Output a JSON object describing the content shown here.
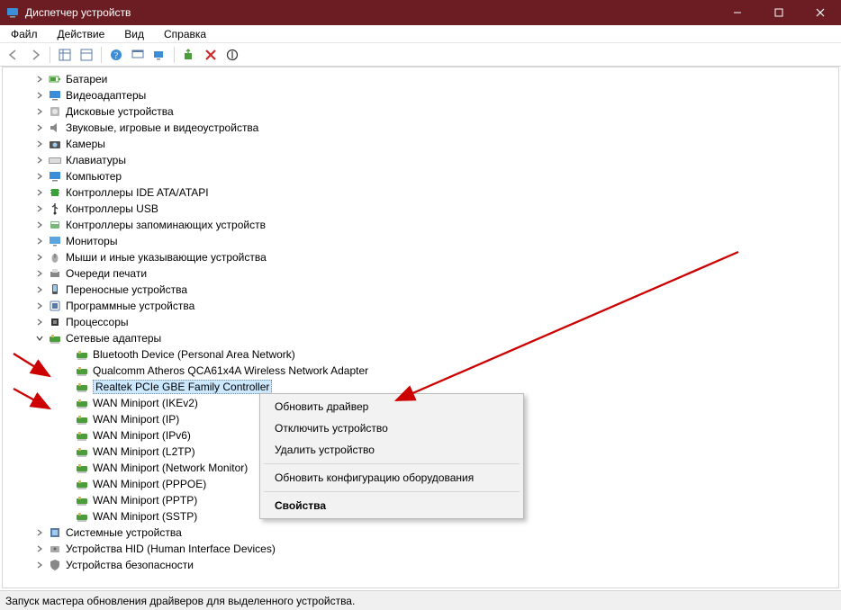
{
  "titlebar": {
    "title": "Диспетчер устройств"
  },
  "menu": {
    "file": "Файл",
    "action": "Действие",
    "view": "Вид",
    "help": "Справка"
  },
  "topCategories": [
    {
      "id": "batteries",
      "label": "Батареи",
      "icon": "battery"
    },
    {
      "id": "video",
      "label": "Видеоадаптеры",
      "icon": "display"
    },
    {
      "id": "diskdrives",
      "label": "Дисковые устройства",
      "icon": "disk"
    },
    {
      "id": "audio",
      "label": "Звуковые, игровые и видеоустройства",
      "icon": "speaker"
    },
    {
      "id": "cameras",
      "label": "Камеры",
      "icon": "camera"
    },
    {
      "id": "keyboards",
      "label": "Клавиатуры",
      "icon": "keyboard"
    },
    {
      "id": "computer",
      "label": "Компьютер",
      "icon": "computer"
    },
    {
      "id": "ide",
      "label": "Контроллеры IDE ATA/ATAPI",
      "icon": "chip"
    },
    {
      "id": "usb",
      "label": "Контроллеры USB",
      "icon": "usb"
    },
    {
      "id": "storagectl",
      "label": "Контроллеры запоминающих устройств",
      "icon": "storagectl"
    },
    {
      "id": "monitors",
      "label": "Мониторы",
      "icon": "monitor"
    },
    {
      "id": "mice",
      "label": "Мыши и иные указывающие устройства",
      "icon": "mouse"
    },
    {
      "id": "printq",
      "label": "Очереди печати",
      "icon": "printer"
    },
    {
      "id": "portable",
      "label": "Переносные устройства",
      "icon": "portable"
    },
    {
      "id": "software",
      "label": "Программные устройства",
      "icon": "softdev"
    },
    {
      "id": "cpus",
      "label": "Процессоры",
      "icon": "cpu"
    }
  ],
  "networkCat": {
    "label": "Сетевые адаптеры",
    "icon": "net"
  },
  "networkChildren": [
    {
      "id": "bt",
      "label": "Bluetooth Device (Personal Area Network)",
      "icon": "net"
    },
    {
      "id": "wifi",
      "label": "Qualcomm Atheros QCA61x4A Wireless Network Adapter",
      "icon": "net"
    },
    {
      "id": "realtek",
      "label": "Realtek PCIe GBE Family Controller",
      "icon": "net",
      "selected": true
    },
    {
      "id": "wan1",
      "label": "WAN Miniport (IKEv2)",
      "icon": "net"
    },
    {
      "id": "wan2",
      "label": "WAN Miniport (IP)",
      "icon": "net"
    },
    {
      "id": "wan3",
      "label": "WAN Miniport (IPv6)",
      "icon": "net"
    },
    {
      "id": "wan4",
      "label": "WAN Miniport (L2TP)",
      "icon": "net"
    },
    {
      "id": "wan5",
      "label": "WAN Miniport (Network Monitor)",
      "icon": "net"
    },
    {
      "id": "wan6",
      "label": "WAN Miniport (PPPOE)",
      "icon": "net"
    },
    {
      "id": "wan7",
      "label": "WAN Miniport (PPTP)",
      "icon": "net"
    },
    {
      "id": "wan8",
      "label": "WAN Miniport (SSTP)",
      "icon": "net"
    }
  ],
  "bottomCategories": [
    {
      "id": "sysdev",
      "label": "Системные устройства",
      "icon": "system"
    },
    {
      "id": "hid",
      "label": "Устройства HID (Human Interface Devices)",
      "icon": "hid"
    },
    {
      "id": "security",
      "label": "Устройства безопасности",
      "icon": "security"
    }
  ],
  "context": {
    "updateDriver": "Обновить драйвер",
    "disable": "Отключить устройство",
    "delete": "Удалить устройство",
    "rescan": "Обновить конфигурацию оборудования",
    "properties": "Свойства"
  },
  "statusbar": {
    "text": "Запуск мастера обновления драйверов для выделенного устройства."
  },
  "colors": {
    "arrow": "#cc0000"
  }
}
